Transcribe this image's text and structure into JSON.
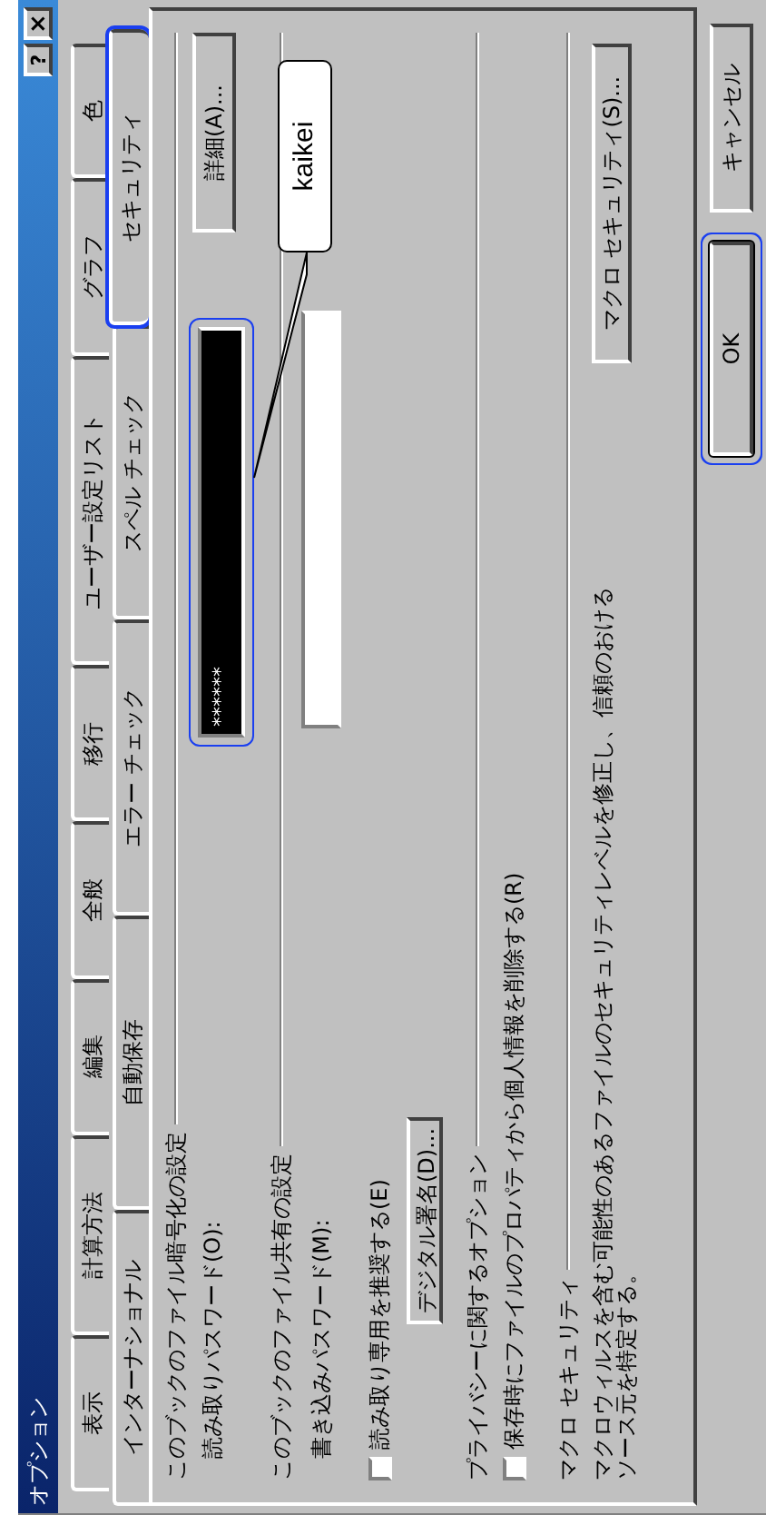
{
  "window": {
    "title": "オプション",
    "help_button": "?",
    "close_button": "×"
  },
  "tabs_back": [
    {
      "label": "表示",
      "selected": false
    },
    {
      "label": "計算方法",
      "selected": false
    },
    {
      "label": "編集",
      "selected": false
    },
    {
      "label": "全般",
      "selected": false
    },
    {
      "label": "移行",
      "selected": false
    },
    {
      "label": "ユーザー設定リスト",
      "selected": false
    },
    {
      "label": "グラフ",
      "selected": false
    },
    {
      "label": "色",
      "selected": false
    }
  ],
  "tabs_front": [
    {
      "label": "インターナショナル",
      "selected": false,
      "highlighted": false
    },
    {
      "label": "自動保存",
      "selected": false,
      "highlighted": false
    },
    {
      "label": "エラー チェック",
      "selected": false,
      "highlighted": false
    },
    {
      "label": "スペル チェック",
      "selected": false,
      "highlighted": false
    },
    {
      "label": "セキュリティ",
      "selected": true,
      "highlighted": true
    }
  ],
  "encryption": {
    "heading": "このブックのファイル暗号化の設定",
    "password_label": "読み取りパスワード(O):",
    "password_value": "******",
    "password_highlighted": true,
    "advanced_button": "詳細(A)..."
  },
  "sharing": {
    "heading": "このブックのファイル共有の設定",
    "password_label": "書き込みパスワード(M):",
    "readonly_checkbox": {
      "label": "読み取り専用を推奨する(E)",
      "checked": false
    },
    "signature_button": "デジタル署名(D)..."
  },
  "privacy": {
    "heading": "プライバシーに関するオプション",
    "remove_info_checkbox": {
      "label": "保存時にファイルのプロパティから個人情報を削除する(R)",
      "checked": false
    }
  },
  "macro": {
    "heading": "マクロ セキュリティ",
    "description": [
      "マクロウィルスを含む可能性のあるファイルのセキュリティレベルを修正し、信頼のおける",
      "ソース元を特定する。"
    ],
    "button": "マクロ セキュリティ(S)..."
  },
  "buttons": [
    {
      "label": "OK",
      "default": true,
      "highlighted": true
    },
    {
      "label": "キャンセル",
      "default": false,
      "highlighted": false
    }
  ],
  "callout": {
    "text": "kaikei"
  }
}
